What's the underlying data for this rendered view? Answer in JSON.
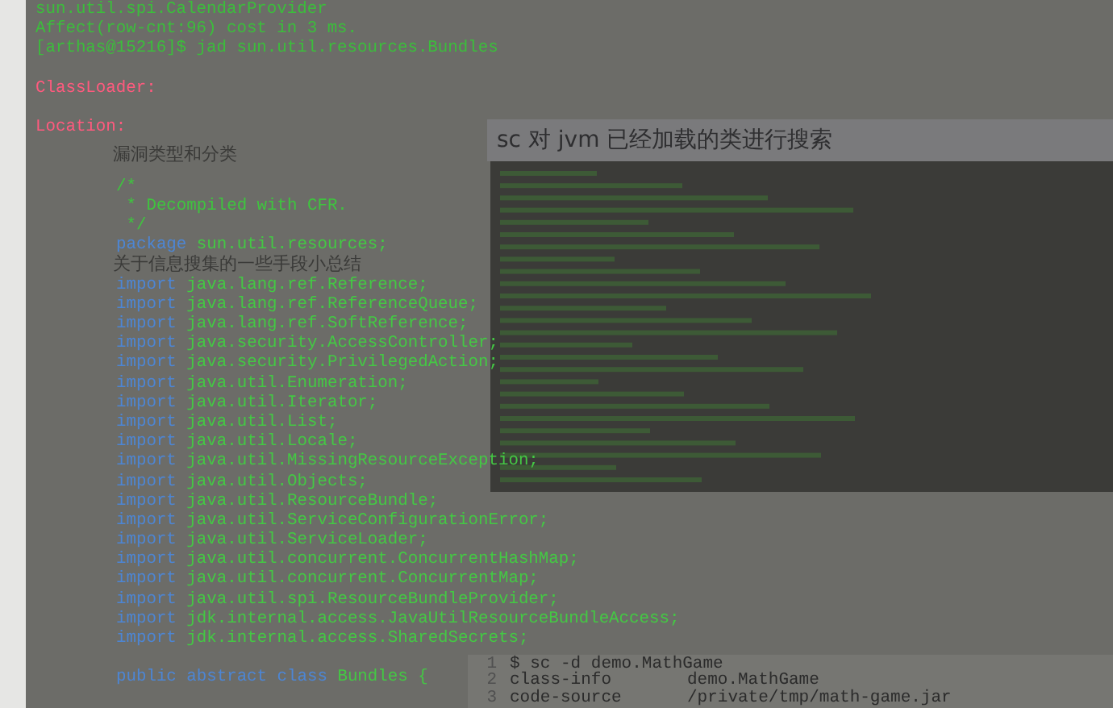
{
  "sidebar": {
    "items": [
      {
        "label": "漏洞类型和分类"
      },
      {
        "label": "关于信息搜集的一些手段小总结"
      }
    ]
  },
  "article": {
    "screenshot_title": "sc 对 jvm 已经加载的类进行搜索",
    "code_block": [
      {
        "number": "1",
        "cells": [
          "$ sc -d demo.MathGame"
        ]
      },
      {
        "number": "2",
        "cells": [
          "class-info",
          "demo.MathGame"
        ]
      },
      {
        "number": "3",
        "cells": [
          "code-source",
          "/private/tmp/math-game.jar"
        ]
      }
    ]
  },
  "terminal": {
    "lines": [
      {
        "kind": "output",
        "text": "sun.util.spi.CalendarProvider"
      },
      {
        "kind": "output",
        "text": "Affect(row-cnt:96) cost in 3 ms."
      },
      {
        "kind": "output",
        "text": "[arthas@15216]$ jad sun.util.resources.Bundles"
      },
      {
        "kind": "blank"
      },
      {
        "kind": "label",
        "text": "ClassLoader:"
      },
      {
        "kind": "blank"
      },
      {
        "kind": "label",
        "text": "Location:"
      },
      {
        "kind": "blank"
      },
      {
        "kind": "blank"
      },
      {
        "kind": "comment",
        "text": "/*"
      },
      {
        "kind": "comment",
        "text": " * Decompiled with CFR."
      },
      {
        "kind": "comment",
        "text": " */"
      },
      {
        "kind": "code",
        "keyword": "package",
        "text": "sun.util.resources;"
      },
      {
        "kind": "blank"
      },
      {
        "kind": "code",
        "keyword": "import",
        "text": "java.lang.ref.Reference;"
      },
      {
        "kind": "code",
        "keyword": "import",
        "text": "java.lang.ref.ReferenceQueue;"
      },
      {
        "kind": "code",
        "keyword": "import",
        "text": "java.lang.ref.SoftReference;"
      },
      {
        "kind": "code",
        "keyword": "import",
        "text": "java.security.AccessController;"
      },
      {
        "kind": "code",
        "keyword": "import",
        "text": "java.security.PrivilegedAction;"
      },
      {
        "kind": "code",
        "keyword": "import",
        "text": "java.util.Enumeration;"
      },
      {
        "kind": "code",
        "keyword": "import",
        "text": "java.util.Iterator;"
      },
      {
        "kind": "code",
        "keyword": "import",
        "text": "java.util.List;"
      },
      {
        "kind": "code",
        "keyword": "import",
        "text": "java.util.Locale;"
      },
      {
        "kind": "code",
        "keyword": "import",
        "text": "java.util.MissingResourceException;"
      },
      {
        "kind": "code",
        "keyword": "import",
        "text": "java.util.Objects;"
      },
      {
        "kind": "code",
        "keyword": "import",
        "text": "java.util.ResourceBundle;"
      },
      {
        "kind": "code",
        "keyword": "import",
        "text": "java.util.ServiceConfigurationError;"
      },
      {
        "kind": "code",
        "keyword": "import",
        "text": "java.util.ServiceLoader;"
      },
      {
        "kind": "code",
        "keyword": "import",
        "text": "java.util.concurrent.ConcurrentHashMap;"
      },
      {
        "kind": "code",
        "keyword": "import",
        "text": "java.util.concurrent.ConcurrentMap;"
      },
      {
        "kind": "code",
        "keyword": "import",
        "text": "java.util.spi.ResourceBundleProvider;"
      },
      {
        "kind": "code",
        "keyword": "import",
        "text": "jdk.internal.access.JavaUtilResourceBundleAccess;"
      },
      {
        "kind": "code",
        "keyword": "import",
        "text": "jdk.internal.access.SharedSecrets;"
      },
      {
        "kind": "blank"
      },
      {
        "kind": "code",
        "keyword": "public abstract class",
        "text": "Bundles {"
      }
    ]
  }
}
